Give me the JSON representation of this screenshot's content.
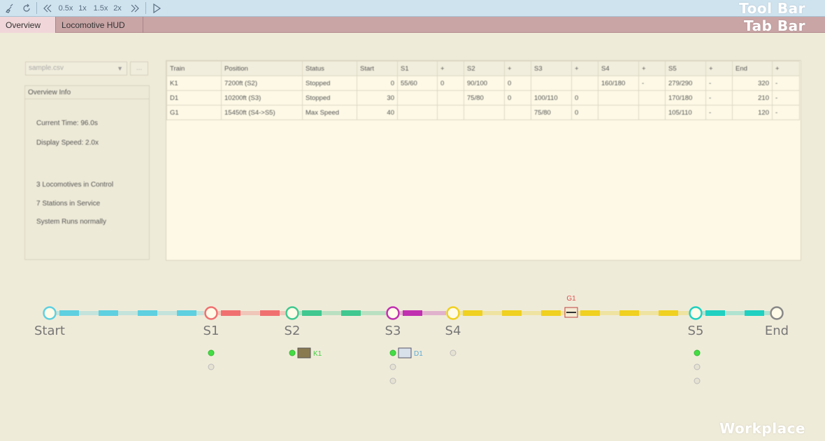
{
  "toolbar": {
    "speed_labels": [
      "0.5x",
      "1x",
      "1.5x",
      "2x"
    ],
    "overlay_label": "Tool Bar"
  },
  "tabbar": {
    "tabs": [
      {
        "label": "Overview",
        "active": true
      },
      {
        "label": "Locomotive HUD",
        "active": false
      }
    ],
    "overlay_label": "Tab Bar"
  },
  "left_panel": {
    "file_select_value": "sample.csv",
    "file_button_label": "...",
    "info_title": "Overview Info",
    "current_time": "Current Time: 96.0s",
    "display_speed": "Display Speed: 2.0x",
    "locomotives": "3 Locomotives in Control",
    "stations": "7 Stations in Service",
    "system_status": "System Runs normally"
  },
  "table": {
    "headers": [
      "Train",
      "Position",
      "Status",
      "Start",
      "S1",
      "+",
      "S2",
      "+",
      "S3",
      "+",
      "S4",
      "+",
      "S5",
      "+",
      "End",
      "+"
    ],
    "rows": [
      [
        "K1",
        "7200ft (S2)",
        "Stopped",
        "0",
        "55/60",
        "0",
        "90/100",
        "0",
        "",
        "",
        "160/180",
        "-",
        "279/290",
        "-",
        "320",
        "-"
      ],
      [
        "D1",
        "10200ft (S3)",
        "Stopped",
        "30",
        "",
        "",
        "75/80",
        "0",
        "100/110",
        "0",
        "",
        "",
        "170/180",
        "-",
        "210",
        "-"
      ],
      [
        "G1",
        "15450ft (S4->S5)",
        "Max Speed",
        "40",
        "",
        "",
        "",
        "",
        "75/80",
        "0",
        "",
        "",
        "105/110",
        "-",
        "120",
        "-"
      ]
    ]
  },
  "track": {
    "stations": [
      {
        "name": "Start",
        "color": "#5ed0e0"
      },
      {
        "name": "S1",
        "color": "#f07070"
      },
      {
        "name": "S2",
        "color": "#40c890"
      },
      {
        "name": "S3",
        "color": "#c030b0"
      },
      {
        "name": "S4",
        "color": "#f0d020"
      },
      {
        "name": "S5",
        "color": "#20d0c0"
      },
      {
        "name": "End",
        "color": "#888888"
      }
    ],
    "train_labels": {
      "moving": "G1",
      "at_s2": "K1",
      "at_s3": "D1"
    }
  },
  "workplace_label": "Workplace"
}
